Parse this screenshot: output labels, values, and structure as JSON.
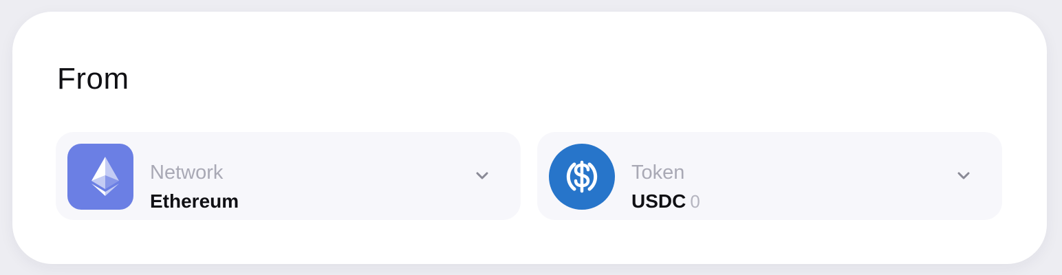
{
  "from": {
    "title": "From",
    "network": {
      "label": "Network",
      "value": "Ethereum",
      "icon": "ethereum-logo",
      "color": "#6b7fe4"
    },
    "token": {
      "label": "Token",
      "value": "USDC",
      "balance": "0",
      "icon": "usdc-logo",
      "color": "#2775ca"
    }
  }
}
